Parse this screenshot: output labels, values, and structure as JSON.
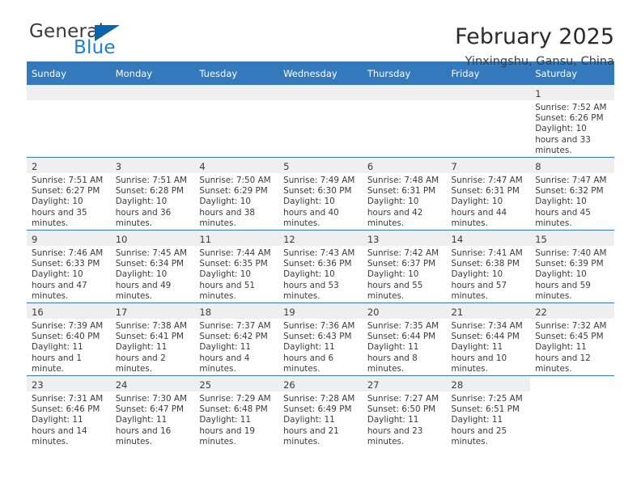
{
  "brand": {
    "name_part1": "General",
    "name_part2": "Blue",
    "triangle_color": "#0a64ad",
    "blue_color": "#1f7fd0"
  },
  "header": {
    "title": "February 2025",
    "subtitle": "Yinxingshu, Gansu, China",
    "header_bg": "#3479bb"
  },
  "calendar": {
    "weekday_headers": [
      "Sunday",
      "Monday",
      "Tuesday",
      "Wednesday",
      "Thursday",
      "Friday",
      "Saturday"
    ],
    "weeks": [
      [
        {
          "day": "",
          "sunrise": "",
          "sunset": "",
          "daylight": ""
        },
        {
          "day": "",
          "sunrise": "",
          "sunset": "",
          "daylight": ""
        },
        {
          "day": "",
          "sunrise": "",
          "sunset": "",
          "daylight": ""
        },
        {
          "day": "",
          "sunrise": "",
          "sunset": "",
          "daylight": ""
        },
        {
          "day": "",
          "sunrise": "",
          "sunset": "",
          "daylight": ""
        },
        {
          "day": "",
          "sunrise": "",
          "sunset": "",
          "daylight": ""
        },
        {
          "day": "1",
          "sunrise": "Sunrise: 7:52 AM",
          "sunset": "Sunset: 6:26 PM",
          "daylight": "Daylight: 10 hours and 33 minutes."
        }
      ],
      [
        {
          "day": "2",
          "sunrise": "Sunrise: 7:51 AM",
          "sunset": "Sunset: 6:27 PM",
          "daylight": "Daylight: 10 hours and 35 minutes."
        },
        {
          "day": "3",
          "sunrise": "Sunrise: 7:51 AM",
          "sunset": "Sunset: 6:28 PM",
          "daylight": "Daylight: 10 hours and 36 minutes."
        },
        {
          "day": "4",
          "sunrise": "Sunrise: 7:50 AM",
          "sunset": "Sunset: 6:29 PM",
          "daylight": "Daylight: 10 hours and 38 minutes."
        },
        {
          "day": "5",
          "sunrise": "Sunrise: 7:49 AM",
          "sunset": "Sunset: 6:30 PM",
          "daylight": "Daylight: 10 hours and 40 minutes."
        },
        {
          "day": "6",
          "sunrise": "Sunrise: 7:48 AM",
          "sunset": "Sunset: 6:31 PM",
          "daylight": "Daylight: 10 hours and 42 minutes."
        },
        {
          "day": "7",
          "sunrise": "Sunrise: 7:47 AM",
          "sunset": "Sunset: 6:31 PM",
          "daylight": "Daylight: 10 hours and 44 minutes."
        },
        {
          "day": "8",
          "sunrise": "Sunrise: 7:47 AM",
          "sunset": "Sunset: 6:32 PM",
          "daylight": "Daylight: 10 hours and 45 minutes."
        }
      ],
      [
        {
          "day": "9",
          "sunrise": "Sunrise: 7:46 AM",
          "sunset": "Sunset: 6:33 PM",
          "daylight": "Daylight: 10 hours and 47 minutes."
        },
        {
          "day": "10",
          "sunrise": "Sunrise: 7:45 AM",
          "sunset": "Sunset: 6:34 PM",
          "daylight": "Daylight: 10 hours and 49 minutes."
        },
        {
          "day": "11",
          "sunrise": "Sunrise: 7:44 AM",
          "sunset": "Sunset: 6:35 PM",
          "daylight": "Daylight: 10 hours and 51 minutes."
        },
        {
          "day": "12",
          "sunrise": "Sunrise: 7:43 AM",
          "sunset": "Sunset: 6:36 PM",
          "daylight": "Daylight: 10 hours and 53 minutes."
        },
        {
          "day": "13",
          "sunrise": "Sunrise: 7:42 AM",
          "sunset": "Sunset: 6:37 PM",
          "daylight": "Daylight: 10 hours and 55 minutes."
        },
        {
          "day": "14",
          "sunrise": "Sunrise: 7:41 AM",
          "sunset": "Sunset: 6:38 PM",
          "daylight": "Daylight: 10 hours and 57 minutes."
        },
        {
          "day": "15",
          "sunrise": "Sunrise: 7:40 AM",
          "sunset": "Sunset: 6:39 PM",
          "daylight": "Daylight: 10 hours and 59 minutes."
        }
      ],
      [
        {
          "day": "16",
          "sunrise": "Sunrise: 7:39 AM",
          "sunset": "Sunset: 6:40 PM",
          "daylight": "Daylight: 11 hours and 1 minute."
        },
        {
          "day": "17",
          "sunrise": "Sunrise: 7:38 AM",
          "sunset": "Sunset: 6:41 PM",
          "daylight": "Daylight: 11 hours and 2 minutes."
        },
        {
          "day": "18",
          "sunrise": "Sunrise: 7:37 AM",
          "sunset": "Sunset: 6:42 PM",
          "daylight": "Daylight: 11 hours and 4 minutes."
        },
        {
          "day": "19",
          "sunrise": "Sunrise: 7:36 AM",
          "sunset": "Sunset: 6:43 PM",
          "daylight": "Daylight: 11 hours and 6 minutes."
        },
        {
          "day": "20",
          "sunrise": "Sunrise: 7:35 AM",
          "sunset": "Sunset: 6:44 PM",
          "daylight": "Daylight: 11 hours and 8 minutes."
        },
        {
          "day": "21",
          "sunrise": "Sunrise: 7:34 AM",
          "sunset": "Sunset: 6:44 PM",
          "daylight": "Daylight: 11 hours and 10 minutes."
        },
        {
          "day": "22",
          "sunrise": "Sunrise: 7:32 AM",
          "sunset": "Sunset: 6:45 PM",
          "daylight": "Daylight: 11 hours and 12 minutes."
        }
      ],
      [
        {
          "day": "23",
          "sunrise": "Sunrise: 7:31 AM",
          "sunset": "Sunset: 6:46 PM",
          "daylight": "Daylight: 11 hours and 14 minutes."
        },
        {
          "day": "24",
          "sunrise": "Sunrise: 7:30 AM",
          "sunset": "Sunset: 6:47 PM",
          "daylight": "Daylight: 11 hours and 16 minutes."
        },
        {
          "day": "25",
          "sunrise": "Sunrise: 7:29 AM",
          "sunset": "Sunset: 6:48 PM",
          "daylight": "Daylight: 11 hours and 19 minutes."
        },
        {
          "day": "26",
          "sunrise": "Sunrise: 7:28 AM",
          "sunset": "Sunset: 6:49 PM",
          "daylight": "Daylight: 11 hours and 21 minutes."
        },
        {
          "day": "27",
          "sunrise": "Sunrise: 7:27 AM",
          "sunset": "Sunset: 6:50 PM",
          "daylight": "Daylight: 11 hours and 23 minutes."
        },
        {
          "day": "28",
          "sunrise": "Sunrise: 7:25 AM",
          "sunset": "Sunset: 6:51 PM",
          "daylight": "Daylight: 11 hours and 25 minutes."
        },
        {
          "day": "",
          "sunrise": "",
          "sunset": "",
          "daylight": ""
        }
      ]
    ]
  }
}
